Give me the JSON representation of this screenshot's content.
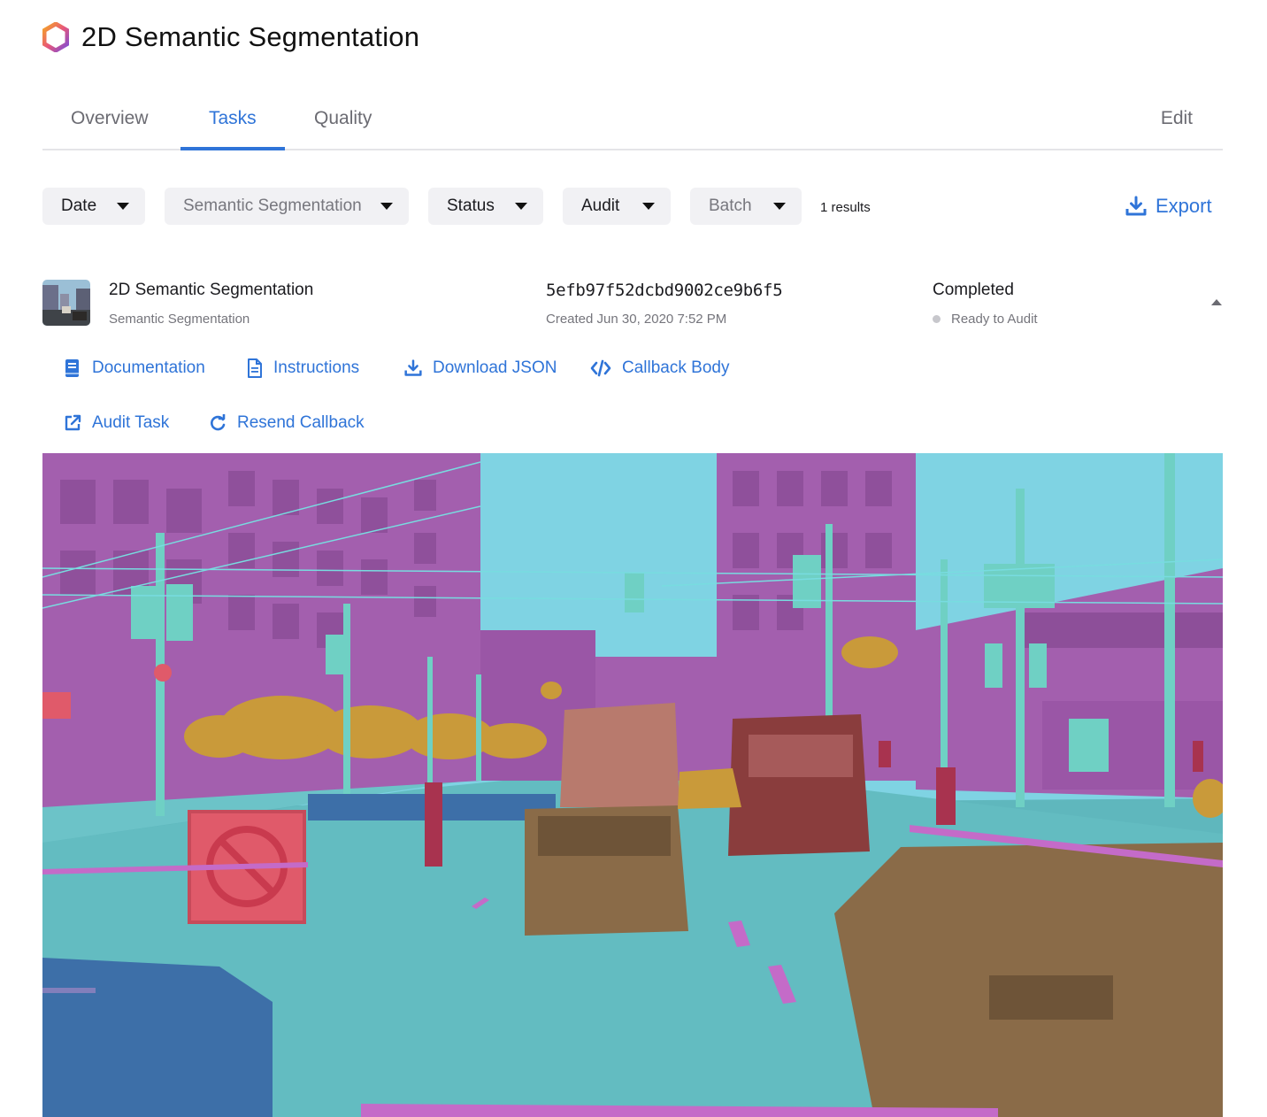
{
  "header": {
    "title": "2D Semantic Segmentation",
    "logo_icon": "hexagon-logo-icon"
  },
  "tabs": [
    {
      "label": "Overview",
      "active": false
    },
    {
      "label": "Tasks",
      "active": true
    },
    {
      "label": "Quality",
      "active": false
    }
  ],
  "edit_label": "Edit",
  "filters": {
    "date": "Date",
    "type": "Semantic Segmentation",
    "status": "Status",
    "audit": "Audit",
    "batch": "Batch"
  },
  "results_text": "1 results",
  "export_label": "Export",
  "task": {
    "name": "2D Semantic Segmentation",
    "type": "Semantic Segmentation",
    "id": "5efb97f52dcbd9002ce9b6f5",
    "created": "Created Jun 30, 2020 7:52 PM",
    "status": "Completed",
    "audit_status": "Ready to Audit"
  },
  "actions": {
    "documentation": "Documentation",
    "instructions": "Instructions",
    "download_json": "Download JSON",
    "callback_body": "Callback Body",
    "audit_task": "Audit Task",
    "resend_callback": "Resend Callback"
  },
  "colors": {
    "accent": "#2f74d8",
    "sky": "#7fd3e3",
    "building": "#a35fae",
    "road": "#5fb7bd",
    "vegetation": "#c99a3a",
    "vehicle": "#8a6b48",
    "pole": "#6fd0c4",
    "sign": "#e05a6a",
    "barrier": "#3d6fa8"
  }
}
